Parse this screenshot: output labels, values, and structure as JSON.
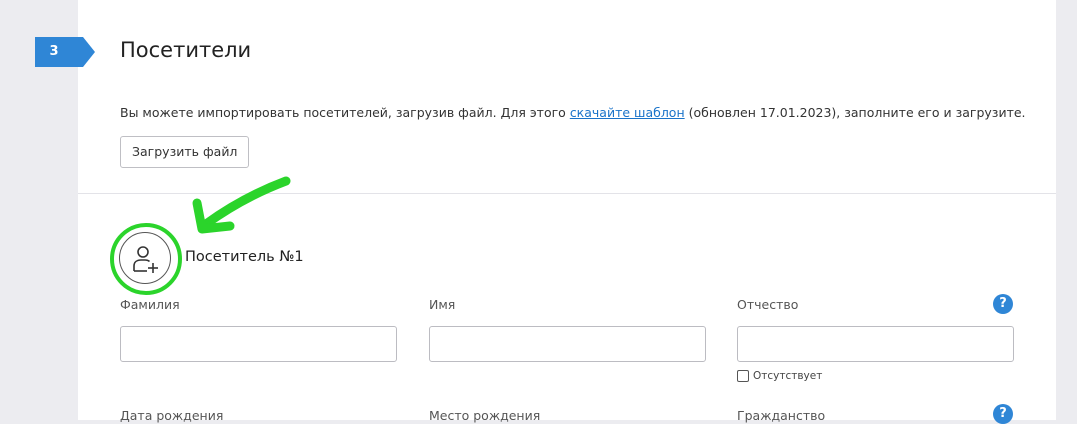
{
  "section": {
    "step_number": "3",
    "title": "Посетители",
    "import_text_before": "Вы можете импортировать посетителей, загрузив файл. Для этого ",
    "import_link": "скачайте шаблон",
    "import_text_after": " (обновлен 17.01.2023), заполните его и загрузите.",
    "upload_button": "Загрузить файл"
  },
  "visitor": {
    "title": "Посетитель №1",
    "add_icon": "user-plus-icon",
    "fields": {
      "last_name": "Фамилия",
      "first_name": "Имя",
      "patronymic": "Отчество",
      "birth_date": "Дата рождения",
      "birth_place": "Место рождения",
      "citizenship": "Гражданство"
    },
    "patronymic_absent": "Отсутствует",
    "help": "?"
  },
  "colors": {
    "badge": "#2f86d6",
    "highlight": "#2bd42b",
    "link": "#1a73c9"
  }
}
